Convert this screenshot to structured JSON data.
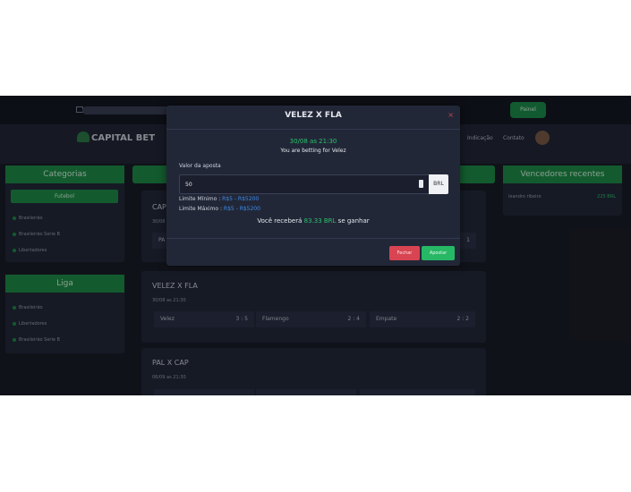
{
  "header": {
    "painel_label": "Painel",
    "logo": {
      "part1": "CAPITAL",
      "part2": "BET"
    },
    "nav": [
      "Indicação",
      "Contato"
    ]
  },
  "sidebar": {
    "categorias_title": "Categorias",
    "futebol_label": "Futebol",
    "categorias_items": [
      "Brasileirão",
      "Brasileirão Serie B",
      "Libertadores"
    ],
    "liga_title": "Liga",
    "liga_items": [
      "Brasileirão",
      "Libertadores",
      "Brasileirão Serie B"
    ]
  },
  "games": [
    {
      "title": "CAP",
      "date": "30/08",
      "row": [
        {
          "name": "PA",
          "odd": ""
        },
        {
          "name": "",
          "odd": "1"
        }
      ]
    },
    {
      "title": "VELEZ X FLA",
      "date": "30/08 as 21:30",
      "row": [
        {
          "name": "Velez",
          "odd": "3 : 5"
        },
        {
          "name": "Flamengo",
          "odd": "2 : 4"
        },
        {
          "name": "Empate",
          "odd": "2 : 2"
        }
      ]
    },
    {
      "title": "PAL X CAP",
      "date": "06/09 as 21:30"
    }
  ],
  "winners": {
    "title": "Vencedores recentes",
    "items": [
      {
        "name": "leandro ribeiro",
        "amount": "225 BRL"
      }
    ]
  },
  "modal": {
    "title": "VELEZ X FLA",
    "close": "×",
    "date": "30/08 as 21:30",
    "subtitle": "You are betting for Velez",
    "valor_label": "Valor da aposta",
    "input_value": "50",
    "currency": "BRL",
    "limit_min_label": "Limite Mínimo : ",
    "limit_min_value": "R$5 - R$5200",
    "limit_max_label": "Limite Máximo : ",
    "limit_max_value": "R$5 - R$5200",
    "receive_prefix": "Você receberá ",
    "receive_amount": "83.33 BRL",
    "receive_suffix": " se ganhar",
    "fechar_label": "Fechar",
    "apostar_label": "Apostar"
  },
  "colors": {
    "accent": "#1e8c48",
    "danger": "#d84451",
    "success": "#26b865",
    "link": "#3d8be8"
  }
}
